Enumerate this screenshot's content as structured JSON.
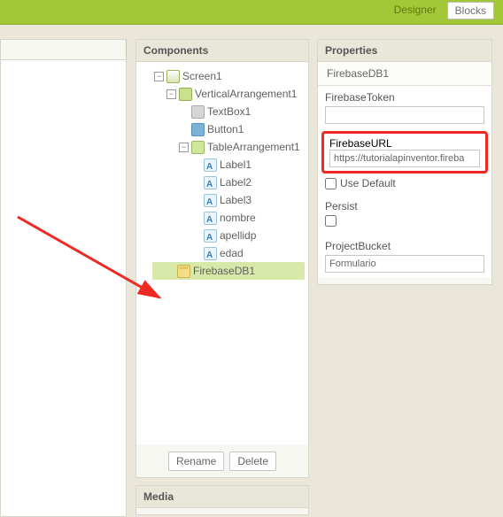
{
  "topbar": {
    "designer": "Designer",
    "blocks": "Blocks"
  },
  "panels": {
    "components": "Components",
    "properties": "Properties",
    "media": "Media"
  },
  "tree": {
    "screen": "Screen1",
    "vertical": "VerticalArrangement1",
    "textbox": "TextBox1",
    "button": "Button1",
    "table": "TableArrangement1",
    "label1": "Label1",
    "label2": "Label2",
    "label3": "Label3",
    "nombre": "nombre",
    "apellidp": "apellidp",
    "edad": "edad",
    "firebase": "FirebaseDB1"
  },
  "buttons": {
    "rename": "Rename",
    "delete": "Delete"
  },
  "props": {
    "component": "FirebaseDB1",
    "token_label": "FirebaseToken",
    "url_label": "FirebaseURL",
    "url_value": "https://tutorialapinventor.fireba",
    "use_default": "Use Default",
    "persist": "Persist",
    "bucket_label": "ProjectBucket",
    "bucket_value": "Formulario"
  }
}
